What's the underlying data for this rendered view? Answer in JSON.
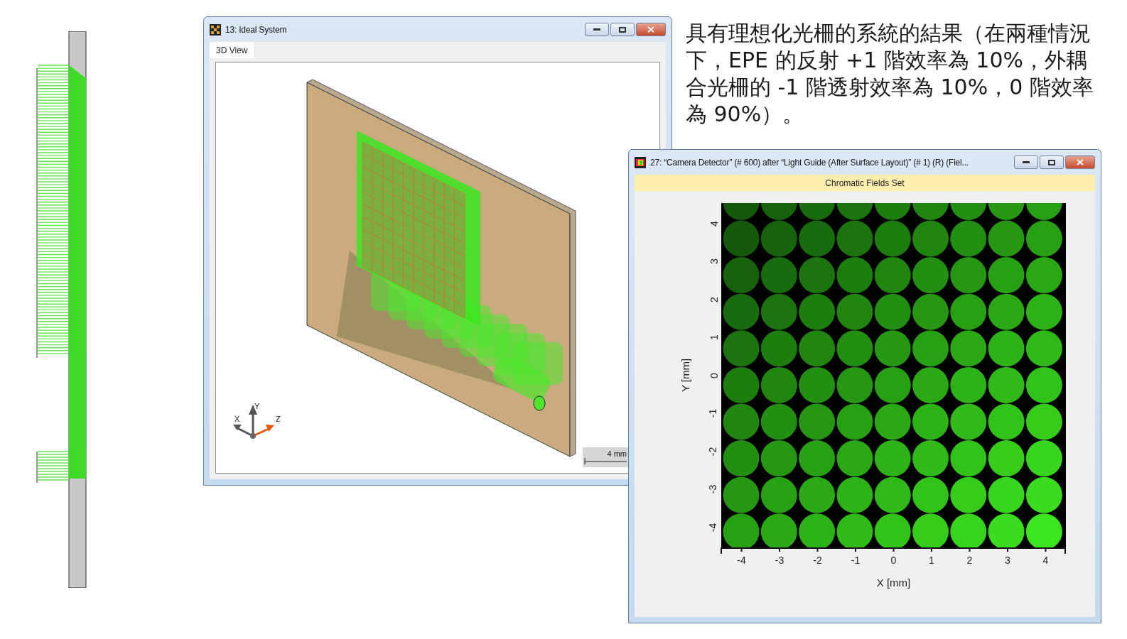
{
  "caption": "具有理想化光柵的系統的結果（在兩種情況下，EPE 的反射 +1 階效率為 10%，外耦合光柵的 -1 階透射效率為 10%，0 階效率為 90%）。",
  "windows": [
    {
      "kind": "view3d",
      "title": "13: Ideal System",
      "tabs": [
        {
          "label": "3D View",
          "selected": true
        }
      ],
      "axes": [
        "X",
        "Y",
        "Z"
      ],
      "scale_label": "4 mm"
    },
    {
      "kind": "detector",
      "title": "27: “Camera Detector” (# 600) after “Light Guide (After Surface Layout)” (# 1) (R) (Fiel...",
      "band": "Chromatic Fields Set",
      "plot": {
        "xlabel": "X [mm]",
        "ylabel": "Y [mm]",
        "xticks": [
          "-4",
          "-3",
          "-2",
          "-1",
          "0",
          "1",
          "2",
          "3",
          "4"
        ],
        "yticks": [
          "4",
          "3",
          "2",
          "1",
          "0",
          "-1",
          "-2",
          "-3",
          "-4"
        ]
      }
    }
  ]
}
